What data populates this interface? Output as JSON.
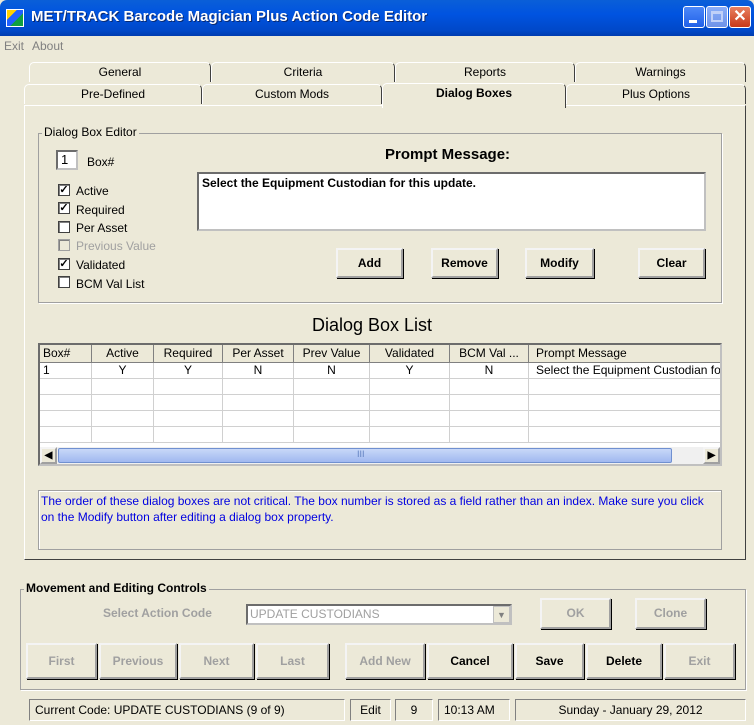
{
  "window": {
    "title": "MET/TRACK Barcode Magician Plus Action Code Editor"
  },
  "menu": {
    "items": [
      "Exit",
      "About"
    ]
  },
  "tabs": {
    "row1": [
      "General",
      "Criteria",
      "Reports",
      "Warnings"
    ],
    "row2": [
      "Pre-Defined",
      "Custom Mods",
      "Dialog Boxes",
      "Plus Options"
    ],
    "active": "Dialog Boxes"
  },
  "dialog_editor": {
    "legend": "Dialog Box Editor",
    "box_number": "1",
    "box_label": "Box#",
    "prompt_label": "Prompt Message:",
    "prompt_value": "Select the Equipment Custodian for this update.",
    "checkboxes": [
      {
        "label": "Active",
        "checked": true,
        "enabled": true
      },
      {
        "label": "Required",
        "checked": true,
        "enabled": true
      },
      {
        "label": "Per Asset",
        "checked": false,
        "enabled": true
      },
      {
        "label": "Previous Value",
        "checked": false,
        "enabled": false
      },
      {
        "label": "Validated",
        "checked": true,
        "enabled": true
      },
      {
        "label": "BCM Val List",
        "checked": false,
        "enabled": true
      }
    ],
    "buttons": {
      "add": "Add",
      "remove": "Remove",
      "modify": "Modify",
      "clear": "Clear"
    }
  },
  "list": {
    "title": "Dialog Box List",
    "columns": [
      "Box#",
      "Active",
      "Required",
      "Per Asset",
      "Prev Value",
      "Validated",
      "BCM Val ...",
      "Prompt Message"
    ],
    "rows": [
      [
        "1",
        "Y",
        "Y",
        "N",
        "N",
        "Y",
        "N",
        "Select the Equipment Custodian fo"
      ]
    ],
    "scroll_grip": "III"
  },
  "info_text": "The order of these dialog boxes are not critical. The box number is stored as a field rather than an index. Make sure you click on the Modify button after editing a dialog box property.",
  "movement": {
    "legend": "Movement and Editing Controls",
    "select_label": "Select Action Code",
    "select_value": "UPDATE CUSTODIANS",
    "ok": "OK",
    "clone": "Clone",
    "nav_buttons": [
      {
        "label": "First",
        "enabled": false
      },
      {
        "label": "Previous",
        "enabled": false
      },
      {
        "label": "Next",
        "enabled": false
      },
      {
        "label": "Last",
        "enabled": false
      },
      {
        "label": "Add New",
        "enabled": false
      },
      {
        "label": "Cancel",
        "enabled": true
      },
      {
        "label": "Save",
        "enabled": true
      },
      {
        "label": "Delete",
        "enabled": true
      },
      {
        "label": "Exit",
        "enabled": false
      }
    ]
  },
  "statusbar": {
    "current_code": "Current Code: UPDATE CUSTODIANS (9 of 9)",
    "mode": "Edit",
    "count": "9",
    "time": "10:13 AM",
    "date": "Sunday - January 29, 2012"
  }
}
